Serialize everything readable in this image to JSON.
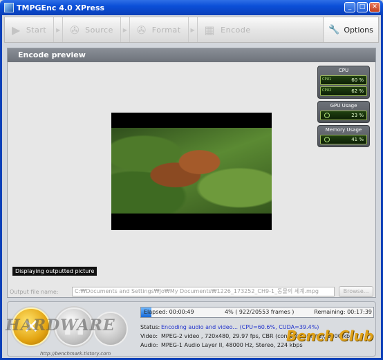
{
  "window": {
    "title": "TMPGEnc 4.0 XPress",
    "buttons": [
      "_",
      "□",
      "✕"
    ]
  },
  "toolbar": {
    "steps": [
      {
        "label": "Start",
        "icon": "play-icon"
      },
      {
        "label": "Source",
        "icon": "film-reel-icon"
      },
      {
        "label": "Format",
        "icon": "film-reel-icon"
      },
      {
        "label": "Encode",
        "icon": "film-strip-icon"
      }
    ],
    "arrow": "▶",
    "options_label": "Options",
    "options_icon": "wrench-icon"
  },
  "panel": {
    "title": "Encode preview",
    "overlay_text": "Displaying outputted picture"
  },
  "monitors": {
    "cpu": {
      "title": "CPU",
      "cores": [
        {
          "label": "CPU1",
          "value": "60 %"
        },
        {
          "label": "CPU2",
          "value": "62 %"
        }
      ]
    },
    "gpu": {
      "title": "GPU Usage",
      "value": "23 %"
    },
    "memory": {
      "title": "Memory Usage",
      "value": "41 %"
    }
  },
  "output": {
    "label": "Output file name:",
    "path": "C:₩Documents and Settings₩Jo₩My Documents₩1226_173252_CH9-1_동물의 세계.mpg",
    "browse_label": "Browse..."
  },
  "progress": {
    "fraction": 0.045,
    "elapsed": "Elapsed: 00:00:49",
    "percent_frames": "4% ( 922/20553  frames )",
    "remaining": "Remaining: 00:17:39"
  },
  "info": {
    "status_key": "Status:",
    "status_value": "Encoding audio and video...     (CPU=60.6%, CUDA=39.4%)",
    "video_key": "Video:",
    "video_value": "MPEG-2 video , 720x480, 29.97 fps, CBR (constant bitrate), 9200 kb",
    "audio_key": "Audio:",
    "audio_value": "MPEG-1 Audio Layer II, 48000 Hz, Stereo, 224 kbps"
  },
  "watermarks": {
    "left": "HARDWARE",
    "url": "http://benchmark.tistory.com",
    "right": "Bench Club"
  },
  "colors": {
    "titlebar": "#0b4fd8",
    "progress": "#1769d6",
    "status_value": "#2233cc",
    "cancel_button": "#e3a412"
  }
}
